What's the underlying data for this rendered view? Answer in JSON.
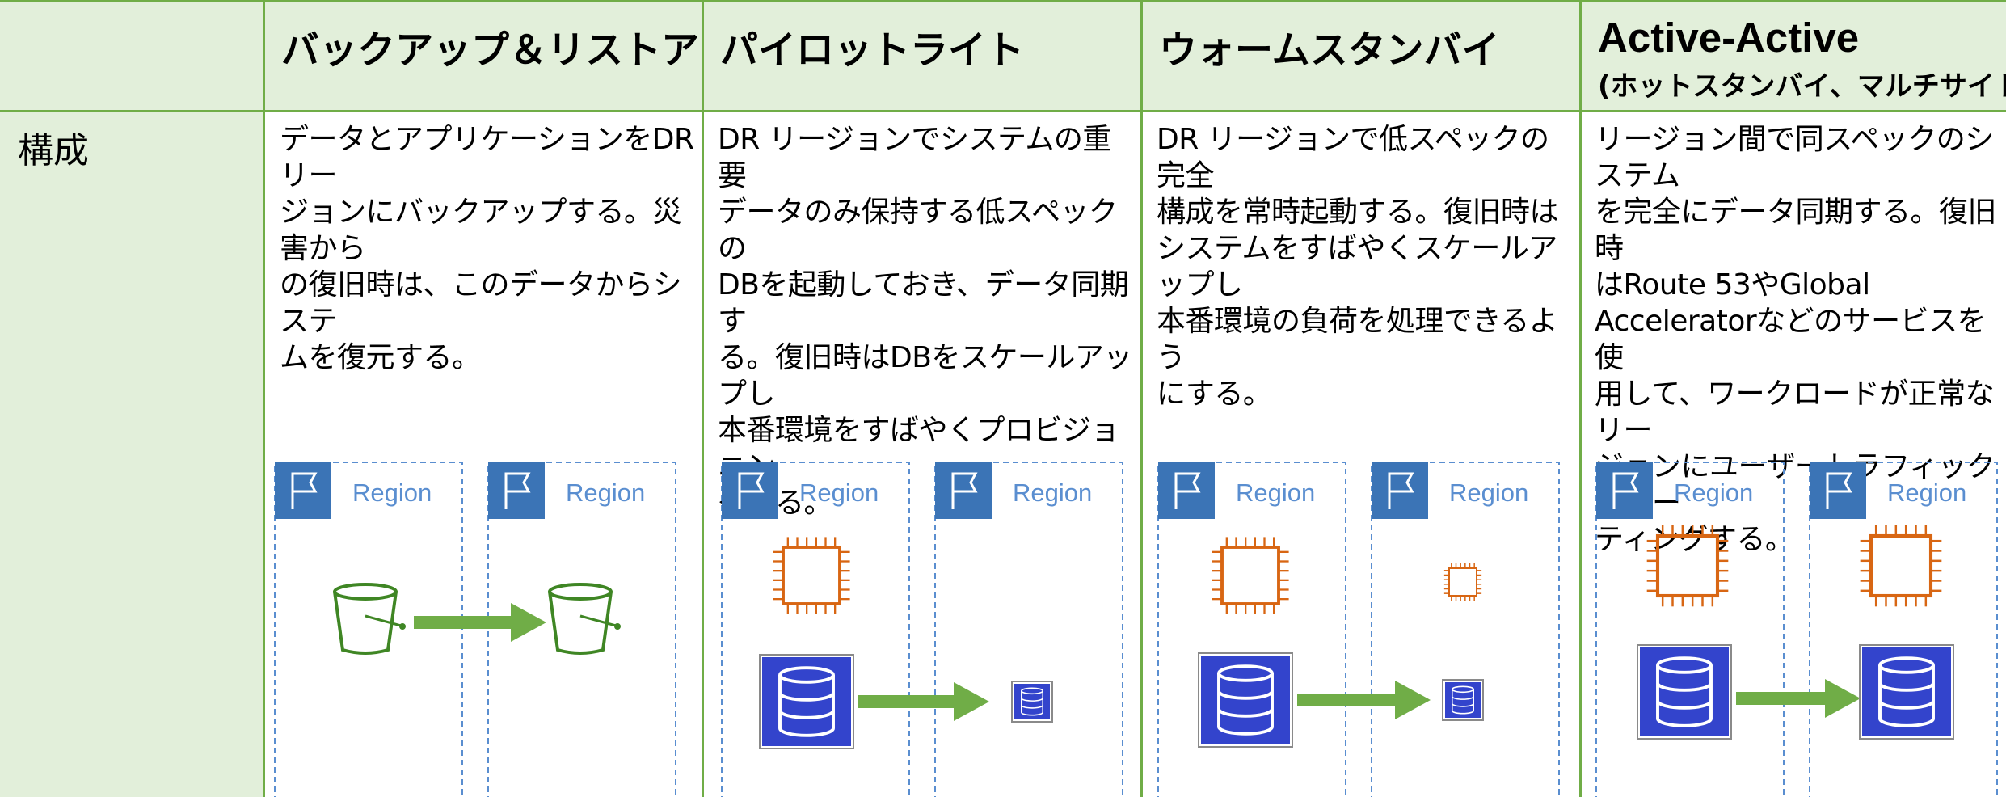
{
  "header": {
    "corner": "",
    "columns": [
      {
        "title": "バックアップ＆リストア",
        "subtitle": ""
      },
      {
        "title": "パイロットライト",
        "subtitle": ""
      },
      {
        "title": "ウォームスタンバイ",
        "subtitle": ""
      },
      {
        "title": "Active-Active",
        "subtitle": "(ホットスタンバイ、マルチサイト)"
      }
    ]
  },
  "row": {
    "label": "構成",
    "cells": [
      "データとアプリケーションをDRリー\nジョンにバックアップする。災害から\nの復旧時は、このデータからシステ\nムを復元する。",
      "DR リージョンでシステムの重要\nデータのみ保持する低スペックの\nDBを起動しておき、データ同期す\nる。復旧時はDBをスケールアップし\n本番環境をすばやくプロビジョニン\nグする。",
      "DR リージョンで低スペックの完全\n構成を常時起動する。復旧時は\nシステムをすばやくスケールアップし\n本番環境の負荷を処理できるよう\nにする。",
      "リージョン間で同スペックのシステム\nを完全にデータ同期する。復旧時\nはRoute 53やGlobal\nAcceleratorなどのサービスを使\n用して、ワークロードが正常なリー\nジョンにユーザートラフィックをルー\nティングする。"
    ]
  },
  "region_label": "Region",
  "icons": {
    "region_flag": "flag-icon",
    "storage": "s3-bucket-icon",
    "compute": "ec2-chip-icon",
    "database": "database-icon",
    "arrow": "replication-arrow"
  },
  "colors": {
    "header_bg": "#e2efda",
    "grid_line": "#70ad47",
    "region_border": "#5a8ed0",
    "region_flag_bg": "#3b74b6",
    "bucket": "#3f8624",
    "chip": "#d86613",
    "db_bg": "#3344cc",
    "arrow": "#70ad47"
  }
}
